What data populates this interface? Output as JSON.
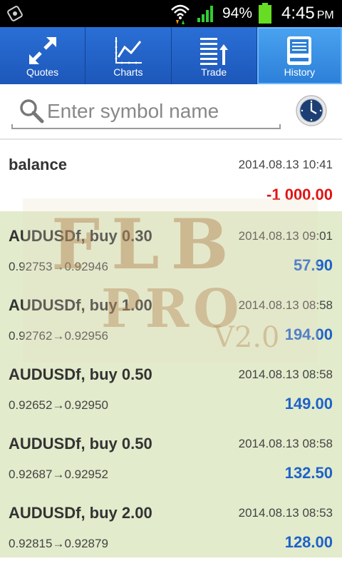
{
  "status_bar": {
    "battery_percent": "94%",
    "time": "4:45",
    "ampm": "PM",
    "left_icon": "usb-debug-icon",
    "wifi_icon": "wifi-icon",
    "signal_icon": "signal-icon",
    "battery_icon": "battery-icon"
  },
  "tabs": [
    {
      "label": "Quotes",
      "icon": "quotes-arrows-icon"
    },
    {
      "label": "Charts",
      "icon": "chart-line-icon"
    },
    {
      "label": "Trade",
      "icon": "trade-list-icon"
    },
    {
      "label": "History",
      "icon": "history-icon",
      "active": true
    }
  ],
  "search": {
    "placeholder": "Enter symbol name",
    "value": ""
  },
  "history": [
    {
      "title": "balance",
      "time": "2014.08.13 10:41",
      "prices": "",
      "profit": "-1 000.00",
      "profit_negative": true
    },
    {
      "title": "AUDUSDf, buy 0.30",
      "time": "2014.08.13 09:01",
      "prices": "0.92753→0.92946",
      "profit": "57.90"
    },
    {
      "title": "AUDUSDf, buy 1.00",
      "time": "2014.08.13 08:58",
      "prices": "0.92762→0.92956",
      "profit": "194.00"
    },
    {
      "title": "AUDUSDf, buy 0.50",
      "time": "2014.08.13 08:58",
      "prices": "0.92652→0.92950",
      "profit": "149.00"
    },
    {
      "title": "AUDUSDf, buy 0.50",
      "time": "2014.08.13 08:58",
      "prices": "0.92687→0.92952",
      "profit": "132.50"
    },
    {
      "title": "AUDUSDf, buy 2.00",
      "time": "2014.08.13 08:53",
      "prices": "0.92815→0.92879",
      "profit": "128.00"
    }
  ],
  "watermark": {
    "line1": "FLB",
    "line2": "PRO",
    "version": "V2.0"
  },
  "colors": {
    "tab_bar": "#1d57b9",
    "tab_active": "#3a93e6",
    "deal_row_bg": "#e2ebcb",
    "profit_positive": "#1f62c9",
    "profit_negative": "#e11414"
  }
}
